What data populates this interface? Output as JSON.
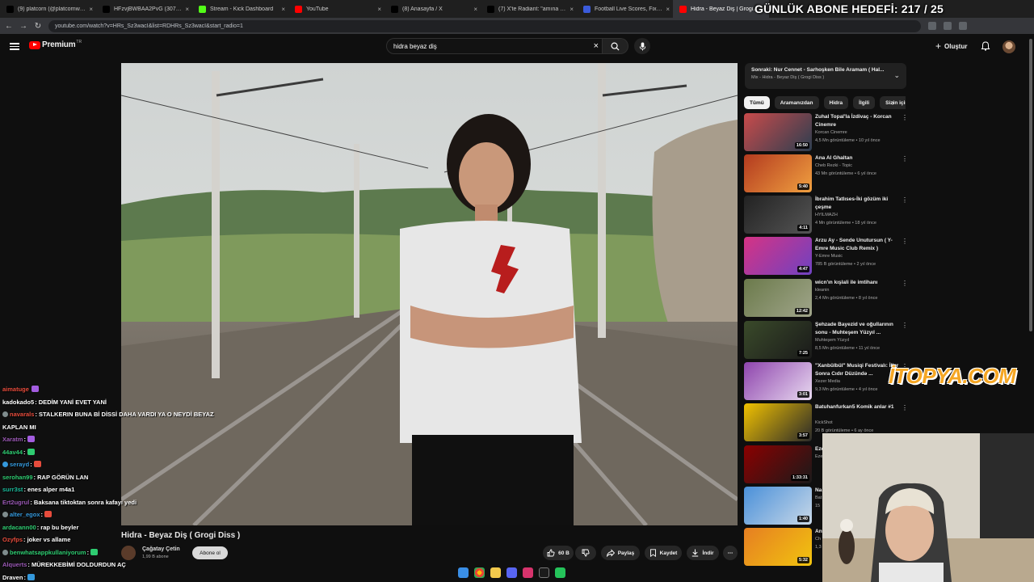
{
  "browser": {
    "tabs": [
      {
        "title": "(9) platcorn (@platcornweb) / X",
        "icon": "x-logo",
        "color": "#000000"
      },
      {
        "title": "HFzvjBWBAA2PvG (3072×4096)",
        "icon": "x-logo",
        "color": "#000000"
      },
      {
        "title": "Stream - Kick Dashboard",
        "icon": "kick-logo",
        "color": "#53fc18"
      },
      {
        "title": "YouTube",
        "icon": "youtube-logo",
        "color": "#ff0000"
      },
      {
        "title": "(8) Anasayfa / X",
        "icon": "x-logo",
        "color": "#000000"
      },
      {
        "title": "(7) X'te Radiant: \"amına koy...",
        "icon": "x-logo",
        "color": "#000000"
      },
      {
        "title": "Football Live Scores, Fixtures &...",
        "icon": "football-logo",
        "color": "#3b5bdb"
      },
      {
        "title": "Hidra - Beyaz Diş | Grogi Diss",
        "icon": "youtube-logo",
        "color": "#ff0000",
        "active": true
      }
    ],
    "url": "youtube.com/watch?v=HRs_Sz3wacI&list=RDHRs_Sz3wacI&start_radio=1"
  },
  "header": {
    "logo_text": "Premium",
    "region": "TR",
    "search_value": "hidra beyaz diş",
    "create_label": "Oluştur"
  },
  "video": {
    "title": "Hidra - Beyaz Diş ( Grogi Diss )",
    "channel": "Çağatay Çetin",
    "subscribers": "1,99 B abone",
    "subscribe_label": "Abone ol",
    "likes": "60 B",
    "share_label": "Paylaş",
    "save_label": "Kaydet",
    "download_label": "İndir"
  },
  "up_next": {
    "title": "Sonraki: Nur Cennet - Sarhoşken Bile Aramam ( Hal...",
    "subtitle": "Mix - Hidra - Beyaz Diş ( Grogi Diss )"
  },
  "chips": [
    "Tümü",
    "Aramanızdan",
    "Hidra",
    "İlgili",
    "Sizin için"
  ],
  "recommendations": [
    {
      "title": "Zuhal Topal'la İzdivaç - Korcan Cinemre",
      "channel": "Korcan Cinemre",
      "meta": "4,5 Mn görüntüleme • 10 yıl önce",
      "duration": "16:50",
      "colors": [
        "#c94b4b",
        "#2c3e50"
      ]
    },
    {
      "title": "Ana Al Ghaltan",
      "channel": "Cheb Rezki - Topic",
      "meta": "43 Mn görüntüleme • 6 yıl önce",
      "duration": "5:40",
      "colors": [
        "#b33a1f",
        "#f0a040"
      ]
    },
    {
      "title": "İbrahim Tatlıses-İki gözüm iki çeşme",
      "channel": "HYILMAZH",
      "meta": "4 Mn görüntüleme • 18 yıl önce",
      "duration": "4:11",
      "colors": [
        "#222222",
        "#555555"
      ]
    },
    {
      "title": "Arzu Ay - Sende Unutursun ( Y-Emre Music Club Remix )",
      "channel": "Y-Emre Music",
      "meta": "785 B görüntüleme • 2 yıl önce",
      "duration": "4:47",
      "colors": [
        "#d63384",
        "#6f42c1"
      ]
    },
    {
      "title": "wicn'ın kışlali ile imtihanı",
      "channel": "kleanin",
      "meta": "2,4 Mn görüntüleme • 8 yıl önce",
      "duration": "12:42",
      "colors": [
        "#6b7a4b",
        "#a0a58a"
      ]
    },
    {
      "title": "Şehzade Bayezid ve oğullarının sonu - Muhteşem Yüzyıl ...",
      "channel": "Muhteşem Yüzyıl",
      "meta": "8,5 Mn görüntüleme • 11 yıl önce",
      "duration": "7:25",
      "colors": [
        "#3a4a2a",
        "#1a1a1a"
      ]
    },
    {
      "title": "\"Xanbülbül\" Musiqi Festivalı: İllər Sonra Cıdır Düzündə ...",
      "channel": "Xezer Media",
      "meta": "9,3 Mn görüntüleme • 4 yıl önce",
      "duration": "3:01",
      "colors": [
        "#8e44ad",
        "#e8d9f0"
      ]
    },
    {
      "title": "Batuhanfurkan5 Komik anlar #1",
      "channel": "KickShot",
      "meta": "20 B görüntüleme • 6 ay önce",
      "duration": "3:57",
      "colors": [
        "#f2c200",
        "#2a2a2a"
      ]
    },
    {
      "title": "Ezel",
      "channel": "Ezel",
      "meta": "",
      "duration": "1:33:31",
      "colors": [
        "#8b0000",
        "#1a1a1a"
      ]
    },
    {
      "title": "Na Off",
      "channel": "Bat",
      "meta": "15",
      "duration": "1:40",
      "colors": [
        "#4a90d9",
        "#c8d8e8"
      ]
    },
    {
      "title": "An",
      "channel": "Ch",
      "meta": "1,3",
      "duration": "5:32",
      "colors": [
        "#e67e22",
        "#f1c40f"
      ]
    }
  ],
  "overlay": {
    "goal_text": "GÜNLÜK ABONE HEDEFİ: 217 / 25",
    "sponsor_text": "İTOPYA.COM"
  },
  "chat": [
    {
      "user": "aimatuge",
      "text": "",
      "color": "#e74c3c"
    },
    {
      "user": "kadokado5",
      "text": ": DEDİM YANİ EVET YANİ",
      "color": "#ffffff"
    },
    {
      "user": "navarals",
      "text": ": STALKERIN BUNA Bİ DİSSİ DAHA VARDI YA O NEYDİ BEYAZ",
      "color": "#e74c3c"
    },
    {
      "user": "",
      "text": "KAPLAN MI",
      "color": "#ffffff"
    },
    {
      "user": "Xaratm",
      "text": ":",
      "color": "#9b59b6"
    },
    {
      "user": "44av44",
      "text": ":",
      "color": "#2ecc71"
    },
    {
      "user": "serayd",
      "text": ":",
      "color": "#3498db"
    },
    {
      "user": "serohan99",
      "text": ": RAP GÖRÜN LAN",
      "color": "#2ecc71"
    },
    {
      "user": "surr3st",
      "text": ": enes alper m4a1",
      "color": "#1abc9c"
    },
    {
      "user": "Ert2ugrul",
      "text": ": Baksana tiktoktan sonra kafayı yedi",
      "color": "#9b59b6"
    },
    {
      "user": "alter_egox",
      "text": ":",
      "color": "#3498db"
    },
    {
      "user": "ardacann00",
      "text": ": rap bu beyler",
      "color": "#2ecc71"
    },
    {
      "user": "Ozyfps",
      "text": ": joker vs allame",
      "color": "#e74c3c"
    },
    {
      "user": "benwhatsappkullaniyorum",
      "text": ":",
      "color": "#2ecc71"
    },
    {
      "user": "Alquerts",
      "text": ": MÜREKKEBİMİ DOLDURDUN AÇ",
      "color": "#9b59b6"
    },
    {
      "user": "Draven",
      "text": ":",
      "color": "#ffffff"
    }
  ]
}
